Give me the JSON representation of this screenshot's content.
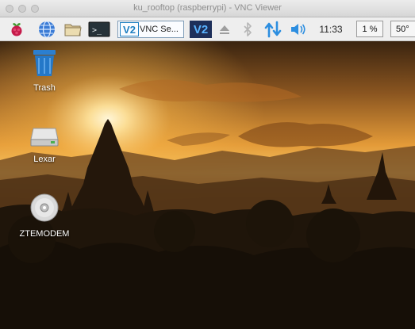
{
  "window": {
    "title": "ku_rooftop (raspberrypi) - VNC Viewer"
  },
  "taskbar": {
    "task_label": "VNC Se...",
    "clock": "11:33",
    "cpu_usage": "1 %",
    "temperature": "50°"
  },
  "desktop": {
    "icons": [
      {
        "label": "Trash",
        "icon": "trash-icon"
      },
      {
        "label": "Lexar",
        "icon": "drive-icon"
      },
      {
        "label": "ZTEMODEM",
        "icon": "disc-icon"
      }
    ]
  },
  "colors": {
    "vnc_blue": "#1e7fc1",
    "taskbar_bg": "#eeeeee",
    "sky_gold": "#f3b24a",
    "sky_dark": "#3a2410"
  }
}
